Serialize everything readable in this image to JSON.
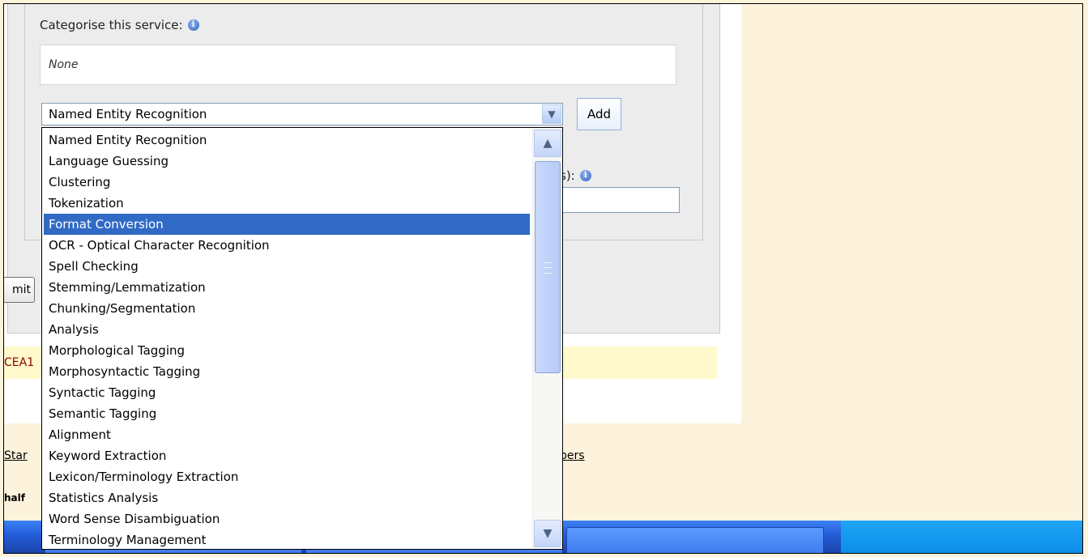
{
  "form": {
    "categorise_label": "Categorise this service:",
    "categories_value": "None",
    "selected_category": "Named Entity Recognition",
    "add_button": "Add",
    "partial_label": "s):",
    "submit_button": "mit"
  },
  "page": {
    "partial_red_text": "CEA1",
    "footer_link_left": "Star",
    "footer_text_left": "half",
    "footer_link_right": "bers"
  },
  "dropdown": {
    "options": [
      "Named Entity Recognition",
      "Language Guessing",
      "Clustering",
      "Tokenization",
      "Format Conversion",
      "OCR - Optical Character Recognition",
      "Spell Checking",
      "Stemming/Lemmatization",
      "Chunking/Segmentation",
      "Analysis",
      "Morphological Tagging",
      "Morphosyntactic Tagging",
      "Syntactic Tagging",
      "Semantic Tagging",
      "Alignment",
      "Keyword Extraction",
      "Lexicon/Terminology Extraction",
      "Statistics Analysis",
      "Word Sense Disambiguation",
      "Terminology Management"
    ],
    "highlighted_index": 4
  },
  "colors": {
    "highlight": "#316ac5",
    "page_background": "#fdf3dc",
    "taskbar": "#245edb"
  },
  "icons": {
    "info": "info-icon",
    "dropdown_arrow": "chevron-down-icon",
    "scroll_up": "chevron-up-icon",
    "scroll_down": "chevron-down-icon"
  }
}
